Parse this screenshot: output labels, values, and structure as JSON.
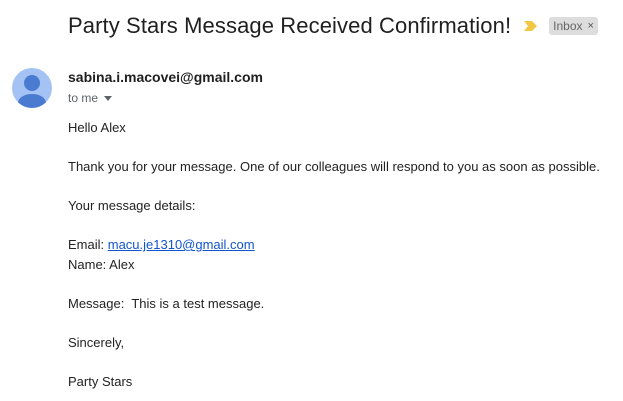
{
  "email": {
    "subject": "Party Stars Message Received Confirmation!",
    "label": "Inbox",
    "label_close": "×",
    "sender": "sabina.i.macovei@gmail.com",
    "recipient_summary": "to me",
    "body": {
      "greeting": "Hello Alex",
      "thanks": "Thank you for your message. One of our colleagues will respond to you as soon as possible.",
      "details_heading": "Your message details:",
      "email_label": "Email: ",
      "email_value": "macu.je1310@gmail.com",
      "name_line": "Name: Alex",
      "message_line": "Message:  This is a test message.",
      "closing": "Sincerely,",
      "signature": "Party Stars"
    }
  },
  "icons": {
    "importance": "importance-marker-icon",
    "avatar": "person-avatar-icon",
    "dropdown": "caret-down-icon"
  },
  "colors": {
    "importance": "#f2c744",
    "avatar_bg": "#a4c2f4",
    "avatar_fg": "#4a7bd0",
    "link": "#1155cc",
    "label_chip_bg": "#dddddd"
  }
}
